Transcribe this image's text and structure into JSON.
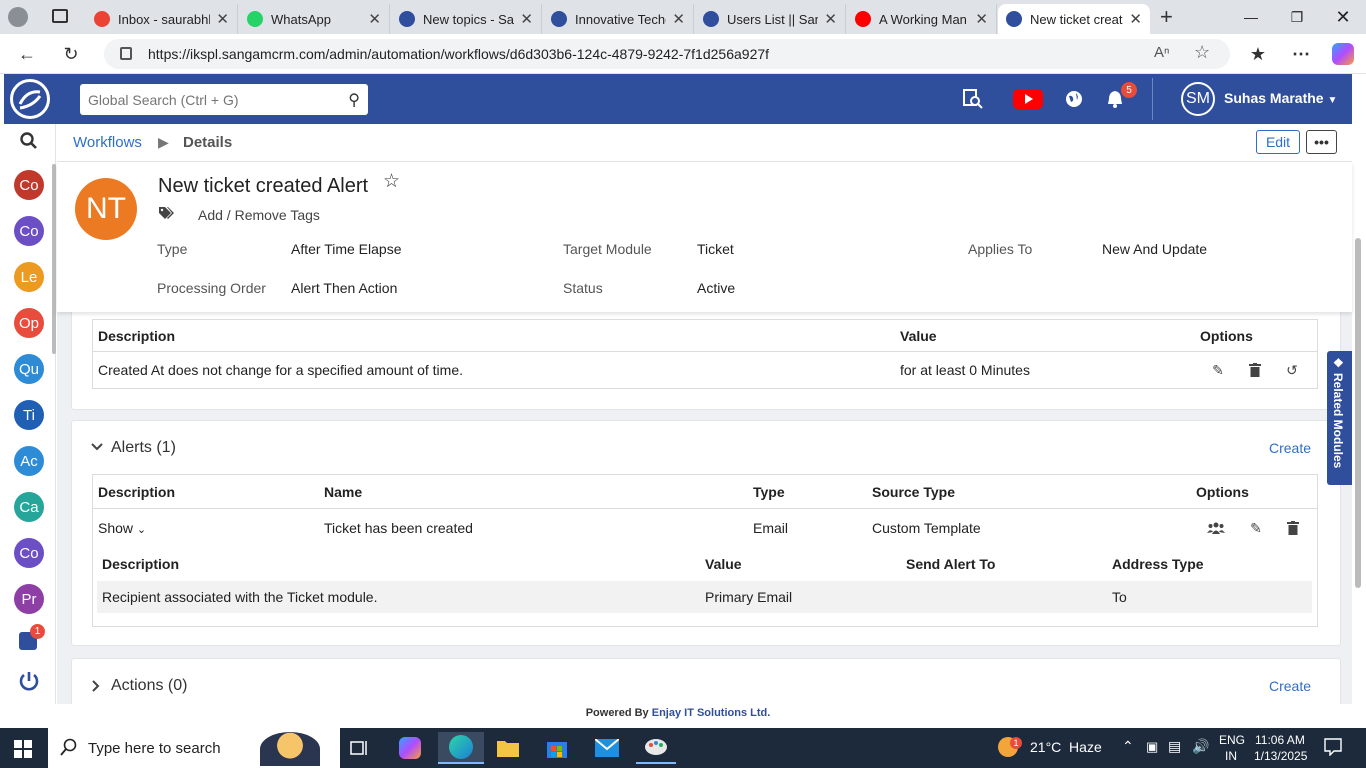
{
  "browser": {
    "tabs": [
      {
        "title": "Inbox - saurabhk",
        "icon": "gmail-icon",
        "color": "#ea4335"
      },
      {
        "title": "WhatsApp",
        "icon": "whatsapp-icon",
        "color": "#25d366"
      },
      {
        "title": "New topics - San",
        "icon": "sangam-icon",
        "color": "#2f4e9b"
      },
      {
        "title": "Innovative Techc",
        "icon": "sangam-icon",
        "color": "#2f4e9b"
      },
      {
        "title": "Users List || Sang",
        "icon": "sangam-icon",
        "color": "#2f4e9b"
      },
      {
        "title": "A Working Man |",
        "icon": "youtube-icon",
        "color": "#ff0000"
      },
      {
        "title": "New ticket create",
        "icon": "sangam-icon",
        "color": "#2f4e9b",
        "active": true
      }
    ],
    "url": "https://ikspl.sangamcrm.com/admin/automation/workflows/d6d303b6-124c-4879-9242-7f1d256a927f"
  },
  "header": {
    "search_placeholder": "Global Search (Ctrl + G)",
    "notification_count": "5",
    "user_initials": "SM",
    "user_name": "Suhas Marathe",
    "brand_color": "#2f4e9b"
  },
  "sidebar": {
    "items": [
      {
        "label": "Co",
        "color": "#c0392b"
      },
      {
        "label": "Co",
        "color": "#6c4fc4"
      },
      {
        "label": "Le",
        "color": "#ec9a22"
      },
      {
        "label": "Op",
        "color": "#e74c3c"
      },
      {
        "label": "Qu",
        "color": "#2e8bd6"
      },
      {
        "label": "Ti",
        "color": "#1f5fb4"
      },
      {
        "label": "Ac",
        "color": "#2e8bd6"
      },
      {
        "label": "Ca",
        "color": "#26a69a"
      },
      {
        "label": "Co",
        "color": "#6c4fc4"
      },
      {
        "label": "Pr",
        "color": "#8e3fa6"
      }
    ],
    "intercom_badge": "1"
  },
  "breadcrumb": {
    "parent": "Workflows",
    "current": "Details",
    "edit_label": "Edit",
    "more_label": "•••"
  },
  "record": {
    "initials": "NT",
    "title": "New ticket created Alert",
    "tags_label": "Add / Remove Tags",
    "fields": {
      "type_label": "Type",
      "type_value": "After Time Elapse",
      "target_label": "Target Module",
      "target_value": "Ticket",
      "applies_label": "Applies To",
      "applies_value": "New And Update",
      "order_label": "Processing Order",
      "order_value": "Alert Then Action",
      "status_label": "Status",
      "status_value": "Active"
    }
  },
  "conditions": {
    "headers": {
      "description": "Description",
      "value": "Value",
      "options": "Options"
    },
    "rows": [
      {
        "description": "Created At does not change for a specified amount of time.",
        "value": "for at least 0 Minutes"
      }
    ]
  },
  "alerts": {
    "title": "Alerts (1)",
    "create_label": "Create",
    "headers": {
      "description": "Description",
      "name": "Name",
      "type": "Type",
      "source": "Source Type",
      "options": "Options"
    },
    "rows": [
      {
        "description": "Show",
        "name": "Ticket has been created",
        "type": "Email",
        "source": "Custom Template"
      }
    ],
    "sub_headers": {
      "description": "Description",
      "value": "Value",
      "send_to": "Send Alert To",
      "address_type": "Address Type"
    },
    "sub_rows": [
      {
        "description": "Recipient associated with the Ticket module.",
        "value": "Primary Email",
        "send_to": "",
        "address_type": "To"
      }
    ]
  },
  "actions": {
    "title": "Actions (0)",
    "create_label": "Create"
  },
  "related_modules_label": "Related Modules",
  "footer": {
    "prefix": "Powered By",
    "company": "Enjay IT Solutions Ltd."
  },
  "taskbar": {
    "search_placeholder": "Type here to search",
    "weather": "21°C  Haze",
    "weather_badge": "1",
    "lang_top": "ENG",
    "lang_bottom": "IN",
    "time": "11:06 AM",
    "date": "1/13/2025"
  }
}
